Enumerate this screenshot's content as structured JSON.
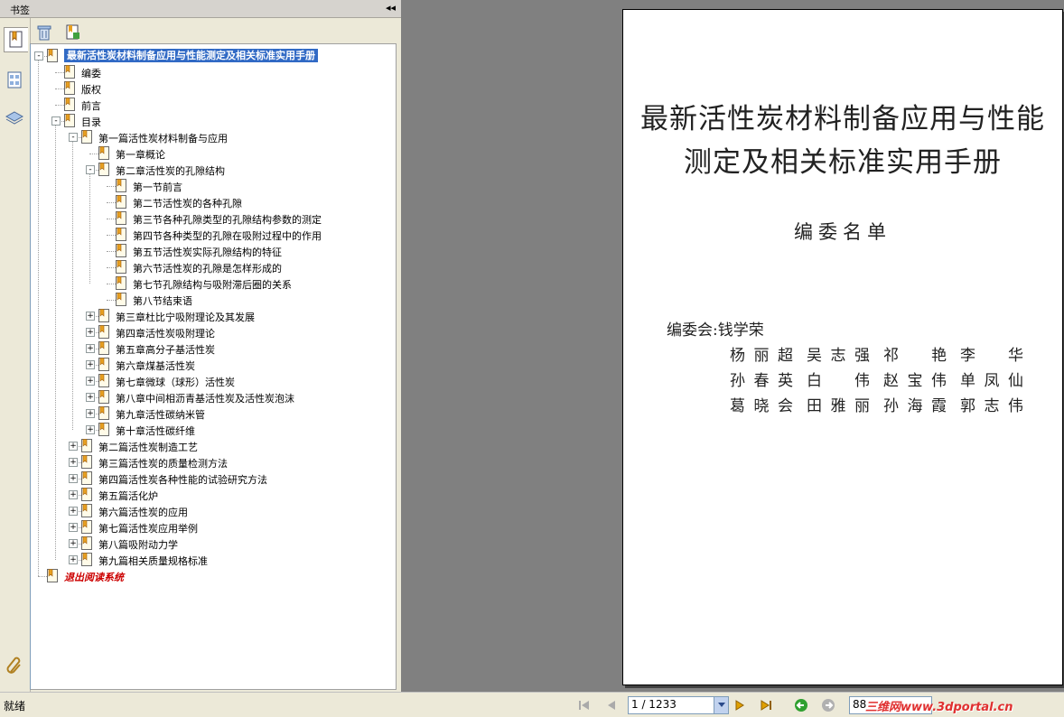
{
  "panel": {
    "title": "书签",
    "collapse_glyph": "◂◂"
  },
  "tree": {
    "root": "最新活性炭材料制备应用与性能测定及相关标准实用手册",
    "front": [
      "编委",
      "版权",
      "前言",
      "目录"
    ],
    "part1": "第一篇活性炭材料制备与应用",
    "ch1": "第一章概论",
    "ch2": "第二章活性炭的孔隙结构",
    "sections": [
      "第一节前言",
      "第二节活性炭的各种孔隙",
      "第三节各种孔隙类型的孔隙结构参数的测定",
      "第四节各种类型的孔隙在吸附过程中的作用",
      "第五节活性炭实际孔隙结构的特征",
      "第六节活性炭的孔隙是怎样形成的",
      "第七节孔隙结构与吸附滞后圈的关系",
      "第八节结束语"
    ],
    "chapters": [
      "第三章杜比宁吸附理论及其发展",
      "第四章活性炭吸附理论",
      "第五章高分子基活性炭",
      "第六章煤基活性炭",
      "第七章微球（球形）活性炭",
      "第八章中间相沥青基活性炭及活性炭泡沫",
      "第九章活性碳纳米管",
      "第十章活性碳纤维"
    ],
    "parts": [
      "第二篇活性炭制造工艺",
      "第三篇活性炭的质量检测方法",
      "第四篇活性炭各种性能的试验研究方法",
      "第五篇活化炉",
      "第六篇活性炭的应用",
      "第七篇活性炭应用举例",
      "第八篇吸附动力学",
      "第九篇相关质量规格标准"
    ],
    "exit": "退出阅读系统"
  },
  "document": {
    "title_line1": "最新活性炭材料制备应用与性能",
    "title_line2": "测定及相关标准实用手册",
    "subtitle": "编委名单",
    "committee_label": "编委会:钱学荣",
    "members": [
      [
        "杨丽超",
        "吴志强",
        "祁　艳",
        "李　华"
      ],
      [
        "孙春英",
        "白　伟",
        "赵宝伟",
        "单凤仙"
      ],
      [
        "葛晓会",
        "田雅丽",
        "孙海霞",
        "郭志伟"
      ]
    ]
  },
  "status": {
    "text": "就绪",
    "page_indicator": "1 / 1233",
    "zoom": "88",
    "watermark": "三维网www.3dportal.cn"
  },
  "colors": {
    "selection": "#316ac5",
    "exit_text": "#cc0000",
    "doc_background": "#808080"
  }
}
